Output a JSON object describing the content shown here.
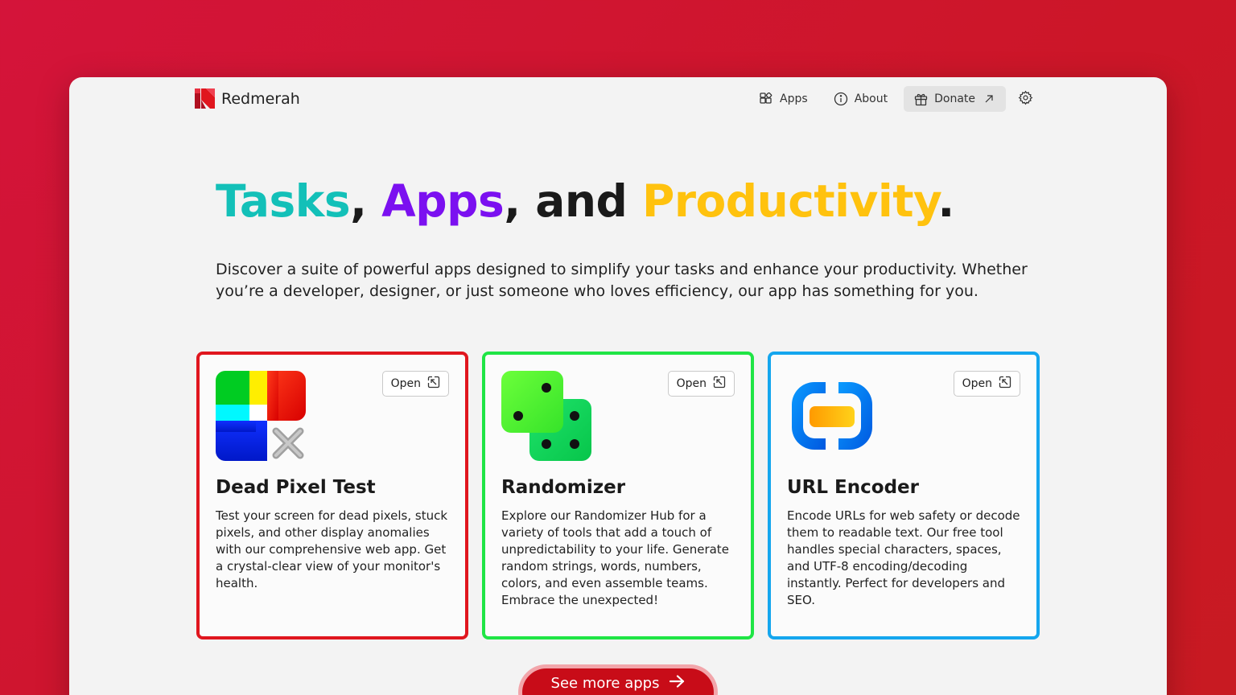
{
  "brand": {
    "name": "Redmerah",
    "logo_icon": "redmerah-logo-icon"
  },
  "nav": {
    "apps": {
      "label": "Apps",
      "icon": "apps-icon"
    },
    "about": {
      "label": "About",
      "icon": "info-icon"
    },
    "donate": {
      "label": "Donate",
      "icon": "gift-icon",
      "trailing_icon": "external-link-icon"
    },
    "settings": {
      "icon": "gear-icon"
    }
  },
  "hero": {
    "title_word1": "Tasks",
    "sep1": ", ",
    "title_word2": "Apps",
    "sep2": ", and ",
    "title_word3": "Productivity",
    "sep3": ".",
    "description": "Discover a suite of powerful apps designed to simplify your tasks and enhance your productivity. Whether you’re a developer, designer, or just someone who loves efficiency, our app has something for you."
  },
  "cards": [
    {
      "title": "Dead Pixel Test",
      "description": "Test your screen for dead pixels, stuck pixels, and other display anomalies with our comprehensive web app. Get a crystal-clear view of your monitor's health.",
      "open_label": "Open",
      "border_color": "#e0161e",
      "icon": "dead-pixel-test-icon"
    },
    {
      "title": "Randomizer",
      "description": "Explore our Randomizer Hub for a variety of tools that add a touch of unpredictability to your life. Generate random strings, words, numbers, colors, and even assemble teams. Embrace the unexpected!",
      "open_label": "Open",
      "border_color": "#1fe545",
      "icon": "dice-icon"
    },
    {
      "title": "URL Encoder",
      "description": "Encode URLs for web safety or decode them to readable text. Our free tool handles special characters, spaces, and UTF-8 encoding/decoding instantly. Perfect for developers and SEO.",
      "open_label": "Open",
      "border_color": "#14a6ee",
      "icon": "link-icon"
    }
  ],
  "see_more": {
    "label": "See more apps",
    "icon": "arrow-right-icon"
  },
  "colors": {
    "background": "#cc1628",
    "tasks": "#13c0b8",
    "apps": "#7b10f0",
    "productivity": "#ffc20e",
    "cta": "#c80c18"
  }
}
